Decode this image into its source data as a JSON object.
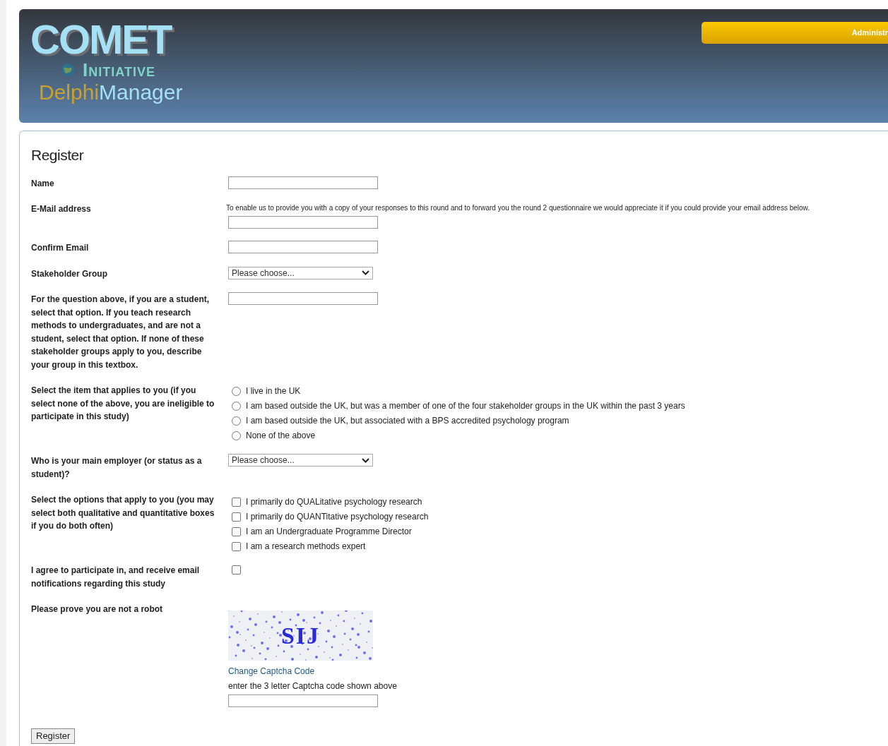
{
  "header": {
    "logo": {
      "word": "COMET",
      "subtitle": "Initiative",
      "product_part1": "Delphi",
      "product_part2": "Manager"
    },
    "admin_button": "Administr"
  },
  "form": {
    "title": "Register",
    "fields": [
      {
        "kind": "text",
        "label": "Name"
      },
      {
        "kind": "text",
        "label": "E-Mail address",
        "note": "To enable us to provide you with a copy of your responses to this round and to forward you the round 2 questionnaire we would appreciate it if you could provide your email address below."
      },
      {
        "kind": "text",
        "label": "Confirm Email"
      },
      {
        "kind": "select",
        "label": "Stakeholder Group",
        "value": "Please choose..."
      },
      {
        "kind": "text",
        "label": "For the question above, if you are a student, select that option. If you teach research methods to undergraduates, and are not a student, select that option. If none of these stakeholder groups apply to you, describe your group in this textbox."
      },
      {
        "kind": "radio",
        "label": "Select the item that applies to you (if you select none of the above, you are ineligible to participate in this study)",
        "options": [
          {
            "label": "I live in the UK",
            "selected": false
          },
          {
            "label": "I am based outside the UK, but was a member of one of the four stakeholder groups in the UK within the past 3 years",
            "selected": false
          },
          {
            "label": "I am based outside the UK, but associated with a BPS accredited psychology program",
            "selected": false
          },
          {
            "label": "None of the above",
            "selected": false
          }
        ]
      },
      {
        "kind": "select",
        "label": "Who is your main employer (or status as a student)?",
        "value": "Please choose..."
      },
      {
        "kind": "checkbox",
        "label": "Select the options that apply to you (you may select both qualitative and quantitative boxes if you do both often)",
        "options": [
          {
            "label": "I primarily do QUALitative psychology research",
            "checked": false
          },
          {
            "label": "I primarily do QUANTitative psychology research",
            "checked": false
          },
          {
            "label": "I am an Undergraduate Programme Director",
            "checked": false
          },
          {
            "label": "I am a research methods expert",
            "checked": false
          }
        ]
      },
      {
        "kind": "agree",
        "label": "I agree to participate in, and receive email notifications regarding this study",
        "checked": false
      },
      {
        "kind": "captcha",
        "label": "Please prove you are not a robot",
        "code": "SIJ",
        "link": "Change Captcha Code",
        "hint": "enter the 3 letter Captcha code shown above"
      }
    ],
    "submit": "Register"
  }
}
